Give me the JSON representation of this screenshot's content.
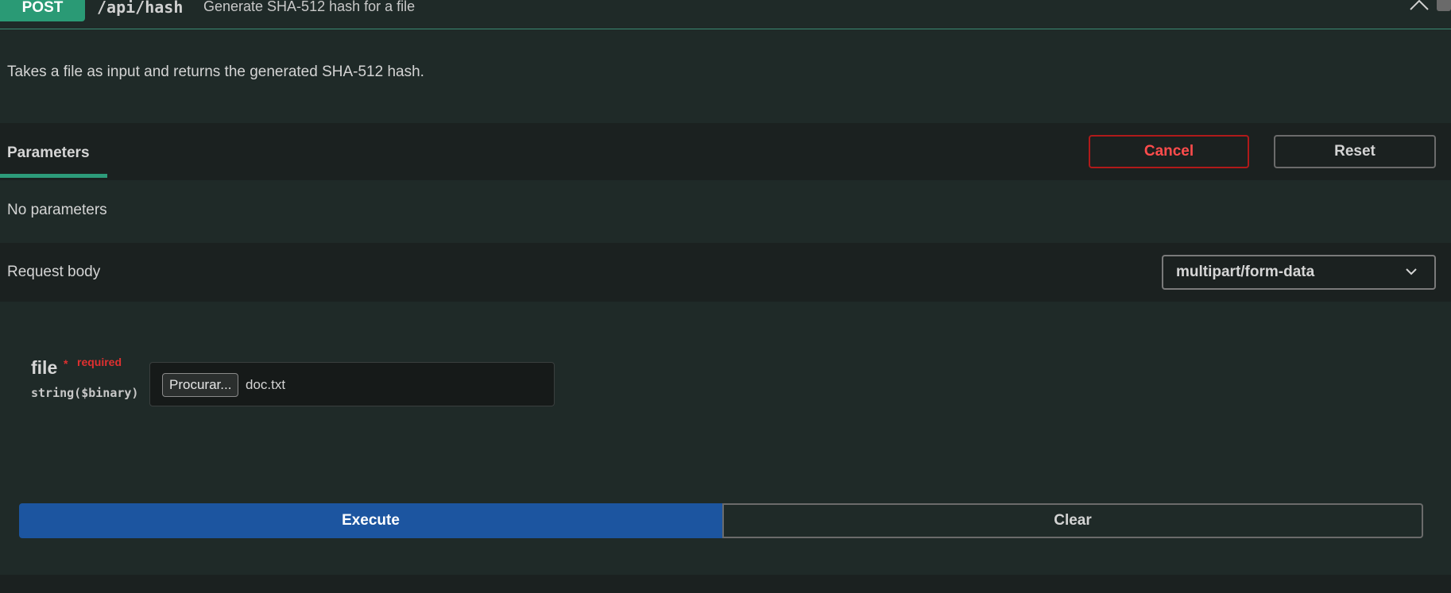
{
  "header": {
    "method": "POST",
    "path": "/api/hash",
    "summary": "Generate SHA-512 hash for a file"
  },
  "description": "Takes a file as input and returns the generated SHA-512 hash.",
  "parameters": {
    "tab_label": "Parameters",
    "cancel_label": "Cancel",
    "reset_label": "Reset",
    "empty_text": "No parameters"
  },
  "request_body": {
    "label": "Request body",
    "content_type": "multipart/form-data"
  },
  "file_field": {
    "name": "file",
    "required_star": "*",
    "required_text": "required",
    "type": "string($binary)",
    "browse_label": "Procurar...",
    "file_name": "doc.txt"
  },
  "actions": {
    "execute_label": "Execute",
    "clear_label": "Clear"
  },
  "colors": {
    "method_post": "#2a9a75",
    "cancel": "#b01a1a",
    "execute": "#1c55a0"
  }
}
